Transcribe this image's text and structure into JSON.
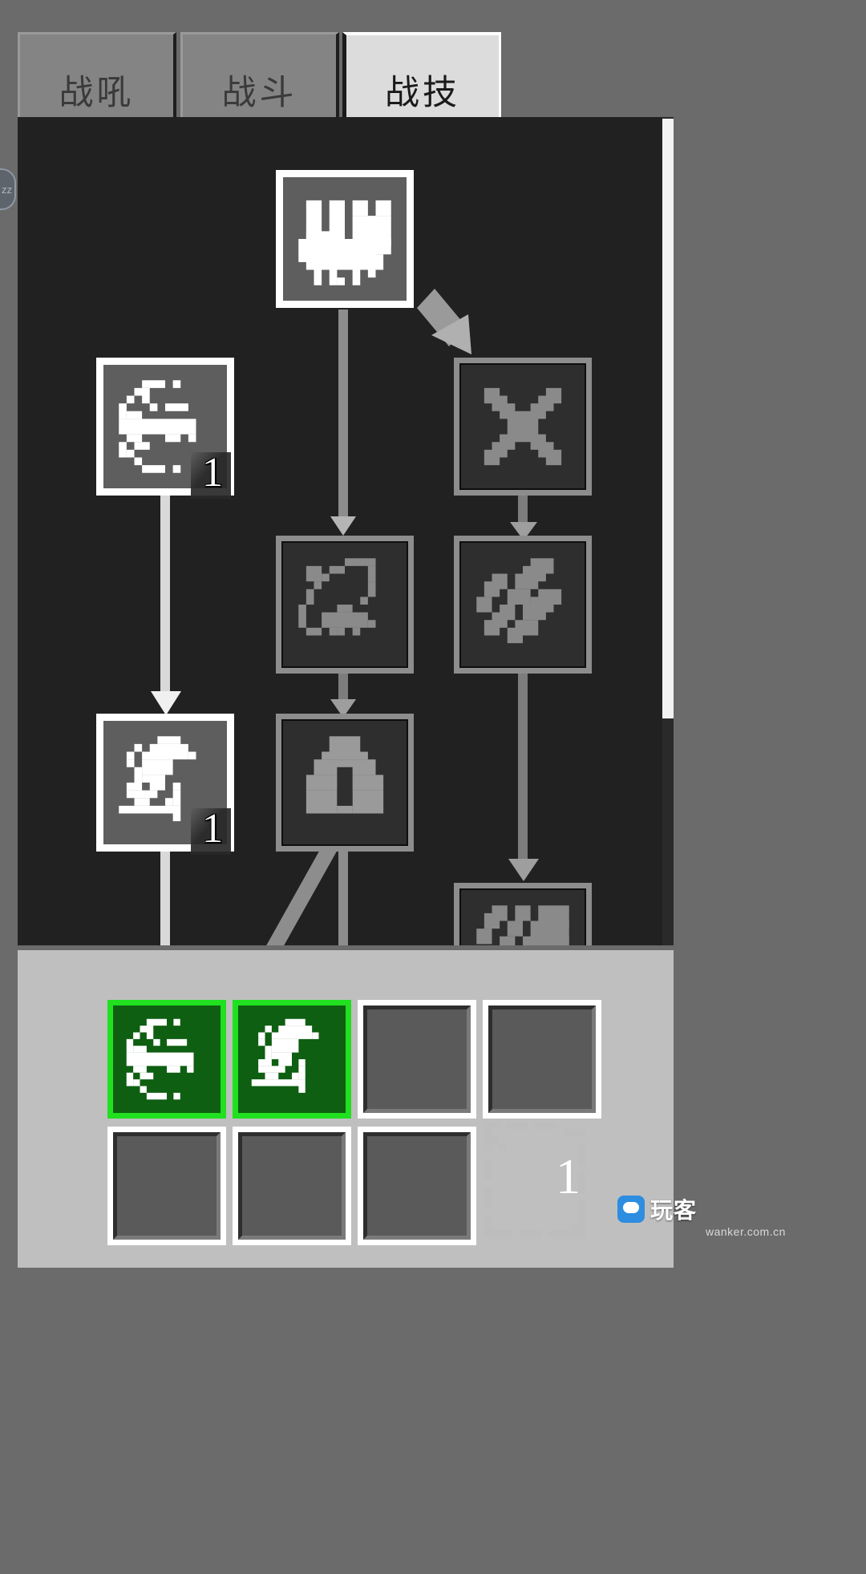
{
  "window": {
    "background_color": "#6b6b6b",
    "panel_color": "#212121",
    "skillbar_color": "#bfbfbf",
    "accent_green": "#20e020"
  },
  "tabs": [
    {
      "label": "战吼",
      "name": "tab-war-cry",
      "active": false
    },
    {
      "label": "战斗",
      "name": "tab-combat",
      "active": false
    },
    {
      "label": "战技",
      "name": "tab-war-skill",
      "active": true
    }
  ],
  "edge_nub": {
    "label": "zz"
  },
  "tree": {
    "nodes": [
      {
        "id": "fist",
        "icon": "fist-icon",
        "state": "unlocked",
        "level": ""
      },
      {
        "id": "dash",
        "icon": "dash-slash-icon",
        "state": "unlocked",
        "level": "1"
      },
      {
        "id": "crossblades",
        "icon": "crossed-blades-icon",
        "state": "locked",
        "level": ""
      },
      {
        "id": "lasso",
        "icon": "lasso-figure-icon",
        "state": "locked",
        "level": ""
      },
      {
        "id": "shards",
        "icon": "falling-shards-icon",
        "state": "locked",
        "level": ""
      },
      {
        "id": "wave",
        "icon": "wave-claw-icon",
        "state": "unlocked",
        "level": "1"
      },
      {
        "id": "brace",
        "icon": "crouch-guard-icon",
        "state": "locked",
        "level": ""
      },
      {
        "id": "rain",
        "icon": "rain-streak-icon",
        "state": "locked",
        "level": ""
      }
    ]
  },
  "scrollbar": {
    "orientation": "vertical",
    "thumb_position": "top"
  },
  "skillbar": {
    "slots": [
      {
        "index": 1,
        "state": "filled",
        "icon": "dash-slash-icon",
        "label": ""
      },
      {
        "index": 2,
        "state": "filled",
        "icon": "wave-claw-icon",
        "label": ""
      },
      {
        "index": 3,
        "state": "empty",
        "icon": "",
        "label": ""
      },
      {
        "index": 4,
        "state": "empty",
        "icon": "",
        "label": ""
      },
      {
        "index": 5,
        "state": "empty",
        "icon": "",
        "label": ""
      },
      {
        "index": 6,
        "state": "empty",
        "icon": "",
        "label": ""
      },
      {
        "index": 7,
        "state": "empty",
        "icon": "",
        "label": ""
      }
    ]
  },
  "item_counter": {
    "count": "1",
    "icon": "rain-streak-icon"
  },
  "watermark": {
    "text": "玩客",
    "url": "wanker.com.cn"
  }
}
